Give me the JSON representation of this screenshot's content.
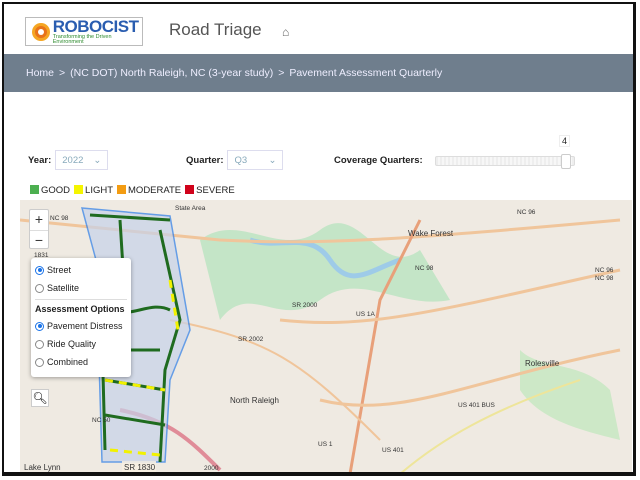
{
  "header": {
    "logo_text": "ROBOCIST",
    "logo_tagline": "Transforming the Driven Environment",
    "title": "Road Triage",
    "home_icon": "home-icon"
  },
  "breadcrumb": [
    "Home",
    "(NC DOT) North Raleigh, NC (3-year study)",
    "Pavement Assessment Quarterly"
  ],
  "breadcrumb_separator": ">",
  "controls": {
    "year_label": "Year:",
    "year_value": "2022",
    "quarter_label": "Quarter:",
    "quarter_value": "Q3",
    "coverage_label": "Coverage Quarters:",
    "coverage_value": "4",
    "coverage_fraction": 1.0
  },
  "legend": [
    {
      "label": "GOOD",
      "color": "#4caf50"
    },
    {
      "label": "LIGHT",
      "color": "#f5f500"
    },
    {
      "label": "MODERATE",
      "color": "#f39c12"
    },
    {
      "label": "SEVERE",
      "color": "#d0021b"
    }
  ],
  "map": {
    "zoom_in": "+",
    "zoom_out": "−",
    "base_layers": [
      {
        "label": "Street",
        "checked": true
      },
      {
        "label": "Satellite",
        "checked": false
      }
    ],
    "assessment_title": "Assessment Options",
    "assessment_options": [
      {
        "label": "Pavement Distress",
        "checked": true
      },
      {
        "label": "Ride Quality",
        "checked": false
      },
      {
        "label": "Combined",
        "checked": false
      }
    ],
    "labels": [
      "NC 98",
      "State Area",
      "Wake Forest",
      "NC 96",
      "1831",
      "NC 98",
      "SR 2000",
      "US 1A",
      "NC 96",
      "NC 98",
      "SR 2002",
      "Rolesville",
      "North Raleigh",
      "US 401 BUS",
      "US 1",
      "US 401",
      "Lake Lynn",
      "2000",
      "SR 1830",
      "NC 50"
    ]
  }
}
